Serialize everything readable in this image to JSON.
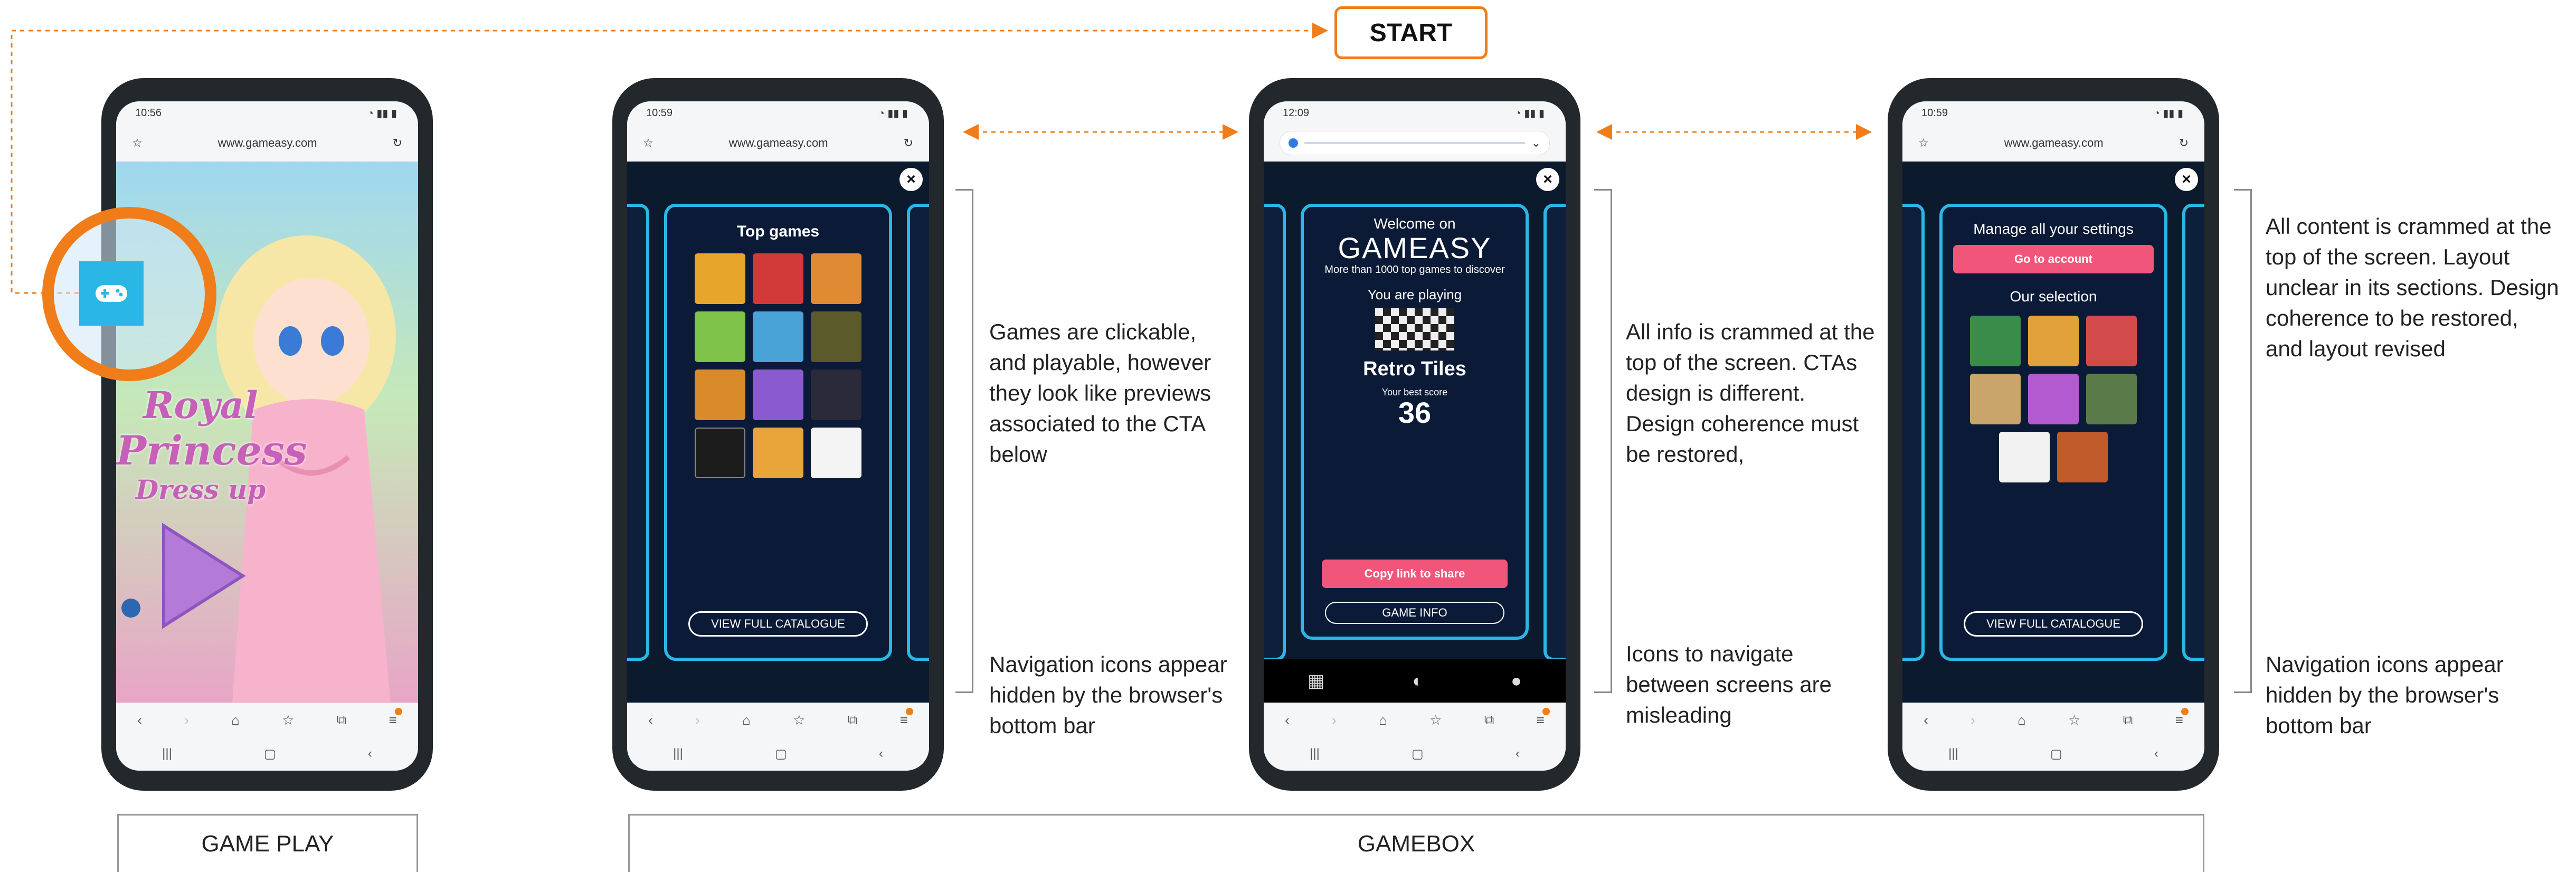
{
  "start_label": "START",
  "colors": {
    "accent_orange": "#f07d1a",
    "gamebox_cyan": "#2bb7e6",
    "gamebox_navy": "#0b1a36",
    "cta_pink": "#f2557a"
  },
  "phones": [
    {
      "time": "10:56",
      "url": "www.gameasy.com",
      "game_title_line1": "Royal",
      "game_title_line2": "Princess",
      "game_title_line3": "Dress up"
    },
    {
      "time": "10:59",
      "url": "www.gameasy.com",
      "card_title": "Top games",
      "cta": "VIEW FULL CATALOGUE"
    },
    {
      "time": "12:09",
      "welcome": "Welcome on",
      "brand": "GAMEASY",
      "subtitle": "More than 1000 top games to discover",
      "playing_label": "You are playing",
      "game_name": "Retro Tiles",
      "best_label": "Your best score",
      "best_score": "36",
      "share_cta": "Copy link to share",
      "info_cta": "GAME INFO"
    },
    {
      "time": "10:59",
      "url": "www.gameasy.com",
      "card_title": "Manage all your settings",
      "account_cta": "Go to account",
      "selection_title": "Our selection",
      "cta": "VIEW FULL CATALOGUE"
    }
  ],
  "annotations": {
    "screen2_top": "Games are clickable, and playable, however they look like previews associated to the CTA below",
    "screen2_bottom": "Navigation icons appear hidden by the browser's bottom bar",
    "screen3_top": "All info is crammed at the top of the screen. CTAs design is different. Design coherence must be restored,",
    "screen3_bottom": "Icons to navigate between screens are misleading",
    "screen4_top": "All content is crammed at the top of the screen. Layout unclear in its sections. Design coherence to be restored, and layout revised",
    "screen4_bottom": "Navigation icons appear hidden by the browser's bottom bar"
  },
  "section_labels": {
    "game_play": "GAME PLAY",
    "gamebox": "GAMEBOX"
  },
  "icons": [
    "gamepad-icon",
    "close-icon",
    "star-icon",
    "refresh-icon",
    "back-icon",
    "forward-icon",
    "home-icon",
    "tabs-icon",
    "menu-icon",
    "grid-icon",
    "user-icon",
    "speaker-icon",
    "play-icon"
  ]
}
